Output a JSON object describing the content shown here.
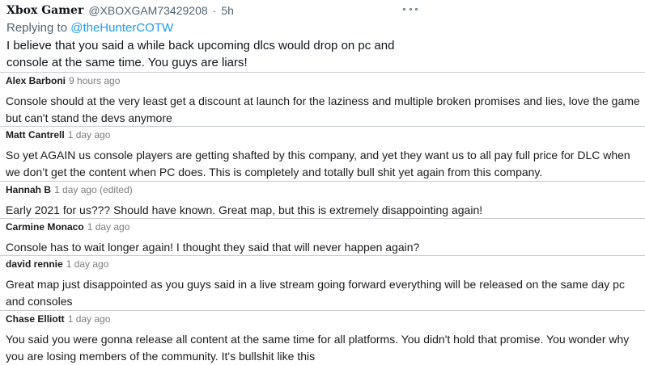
{
  "tweet": {
    "display_name": "Xbox Gamer",
    "handle": "@XBOXGAM73429208",
    "separator": "·",
    "time": "5h",
    "replying_prefix": "Replying to ",
    "replying_to": "@theHunterCOTW",
    "text": "I believe that you said a while back upcoming dlcs would drop on pc and console at the same time. You guys are liars!"
  },
  "comments": [
    {
      "author": "Alex Barboni",
      "time": "9 hours ago",
      "text": "Console should at the very least get a discount at launch for the laziness and multiple broken promises and lies, love the game but can't stand the devs anymore"
    },
    {
      "author": "Matt Cantrell",
      "time": "1 day ago",
      "text": "So yet AGAIN us console players are getting shafted by this company, and yet they want us to all pay full price for DLC when we don’t get the content when PC does. This is completely and totally bull shit yet again from this company."
    },
    {
      "author": "Hannah B",
      "time": "1 day ago (edited)",
      "text": "Early 2021 for us??? Should have known. Great map, but this is extremely disappointing again!"
    },
    {
      "author": "Carmine Monaco",
      "time": "1 day ago",
      "text": "Console has to wait longer again! I thought they said that will never happen again?"
    },
    {
      "author": "david rennie",
      "time": "1 day ago",
      "text": "Great map just disappointed as you guys said in a live stream going forward everything will be released on the same day pc and consoles"
    },
    {
      "author": "Chase Elliott",
      "time": "1 day ago",
      "text": "You said you were gonna release all content at the same time for all platforms. You didn't hold that promise. You wonder why you are losing members of the community. It's bullshit like this"
    }
  ],
  "icons": {
    "more": "more-options-icon"
  }
}
